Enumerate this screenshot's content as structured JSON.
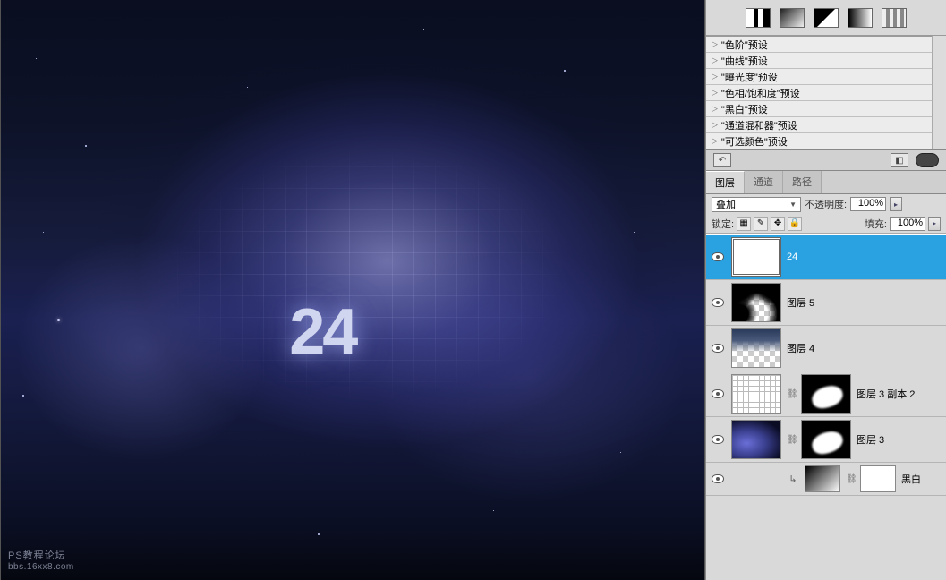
{
  "canvas": {
    "text": "24",
    "watermark_line1": "PS教程论坛",
    "watermark_line2": "bbs.16xx8.com"
  },
  "adjustment_presets": [
    "\"色阶\"预设",
    "\"曲线\"预设",
    "\"曝光度\"预设",
    "\"色相/饱和度\"预设",
    "\"黑白\"预设",
    "\"通道混和器\"预设",
    "\"可选颜色\"预设"
  ],
  "panel_tabs": {
    "layers": "图层",
    "channels": "通道",
    "paths": "路径"
  },
  "blend_mode": {
    "label": "叠加"
  },
  "opacity": {
    "label": "不透明度:",
    "value": "100%"
  },
  "lock": {
    "label": "锁定:"
  },
  "fill": {
    "label": "填充:",
    "value": "100%"
  },
  "layers": [
    {
      "name": "24",
      "selected": true,
      "type": "text"
    },
    {
      "name": "图层 5",
      "type": "mask-blur"
    },
    {
      "name": "图层 4",
      "type": "clouds"
    },
    {
      "name": "图层 3 副本 2",
      "type": "grid-mask"
    },
    {
      "name": "图层 3",
      "type": "nebula-mask"
    },
    {
      "name": "黑白",
      "type": "adj-bw"
    }
  ]
}
